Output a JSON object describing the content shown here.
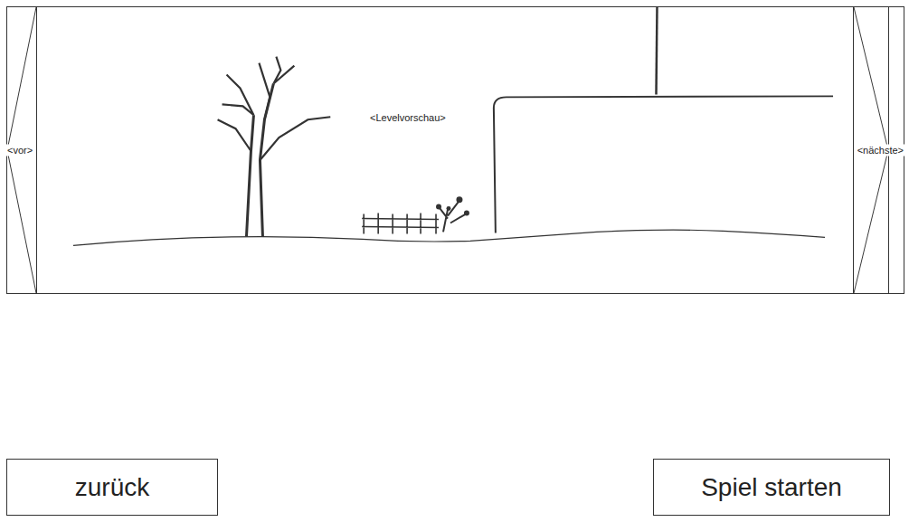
{
  "preview": {
    "caption": "<Levelvorschau>",
    "previous": "<vor>",
    "next": "<nächste>"
  },
  "buttons": [
    {
      "label": "zurück"
    },
    {
      "label": "Spiel starten"
    }
  ]
}
